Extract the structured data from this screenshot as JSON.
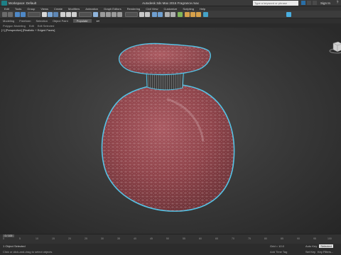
{
  "app": {
    "workspace": "Workspace: Default",
    "title": "Autodesk 3ds Max 2016   Fragrance.max",
    "search_placeholder": "Type a keyword or phrase",
    "sign_in": "Sign In"
  },
  "menu": [
    "Edit",
    "Tools",
    "Group",
    "Views",
    "Create",
    "Modifiers",
    "Animation",
    "Graph Editors",
    "Rendering",
    "Civil View",
    "Customize",
    "Scripting",
    "Help"
  ],
  "ribbon": {
    "tabs": [
      "Modeling",
      "Freeform",
      "Selection",
      "Object Paint"
    ],
    "populate": "Populate"
  },
  "subribbon": [
    "Polygon Modeling",
    "Edit",
    "Edit Selected"
  ],
  "viewport": {
    "label": "[+] [Perspective] [Realistic + Edged Faces]",
    "colors": {
      "mesh": "#8a3b42",
      "highlight": "#4ec3e8",
      "wire": "#c9a7ab"
    }
  },
  "timeline": {
    "frame_display": "0 / 100",
    "ticks": [
      "0",
      "5",
      "10",
      "15",
      "20",
      "25",
      "30",
      "35",
      "40",
      "45",
      "50",
      "55",
      "60",
      "65",
      "70",
      "75",
      "80",
      "85",
      "90",
      "95",
      "100"
    ]
  },
  "status": {
    "selection": "1 Object Selected",
    "hint": "Click or click-and-drag to select objects",
    "add_time_tag": "Add Time Tag",
    "grid": "Grid = 10.0",
    "auto_key": "Auto Key",
    "set_key": "Set Key",
    "selected": "Selected",
    "key_filters": "Key Filters..."
  }
}
